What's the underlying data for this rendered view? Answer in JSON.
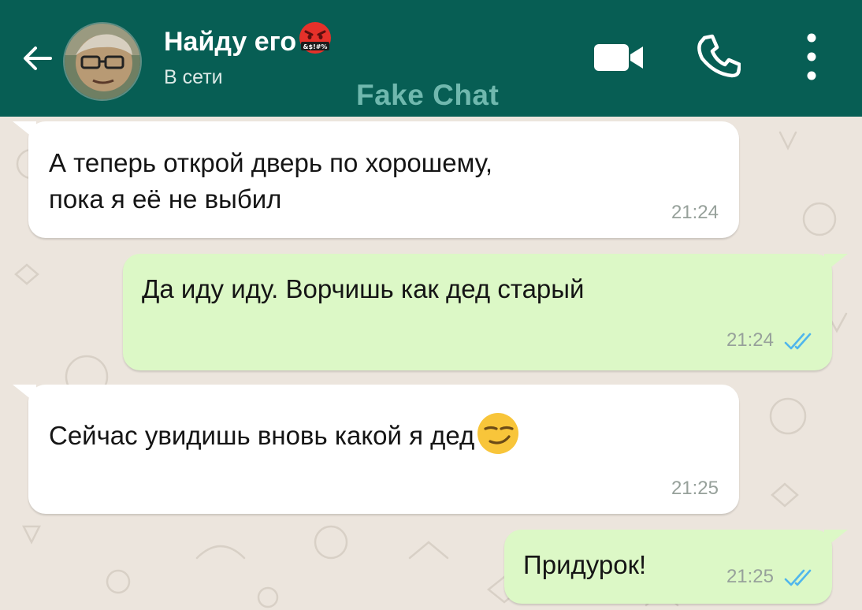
{
  "header": {
    "contact_name": "Найду его",
    "name_emoji": "face-with-symbols-on-mouth-emoji",
    "emoji_symbols": "&$!#%",
    "status": "В сети",
    "watermark": "Fake Chat",
    "icons": [
      "back-arrow-icon",
      "video-call-icon",
      "voice-call-icon",
      "more-options-icon"
    ],
    "colors": {
      "bar": "#075e54",
      "watermark": "#7cc2b8"
    }
  },
  "messages": [
    {
      "direction": "incoming",
      "lines": [
        "А теперь открой дверь по хорошему,",
        "пока я её не выбил"
      ],
      "time": "21:24"
    },
    {
      "direction": "outgoing",
      "lines": [
        "Да иду иду. Ворчишь как дед старый"
      ],
      "time": "21:24",
      "status": "read"
    },
    {
      "direction": "incoming",
      "lines": [
        "Сейчас увидишь вновь какой я дед"
      ],
      "emoji": "smirking-face-emoji",
      "time": "21:25"
    },
    {
      "direction": "outgoing",
      "lines": [
        "Придурок!"
      ],
      "time": "21:25",
      "status": "read"
    }
  ],
  "colors": {
    "incoming_bubble": "#ffffff",
    "outgoing_bubble": "#dcf8c6",
    "chat_background": "#ece5dd",
    "read_ticks": "#4fb6ec",
    "timestamp": "#97a19b"
  }
}
